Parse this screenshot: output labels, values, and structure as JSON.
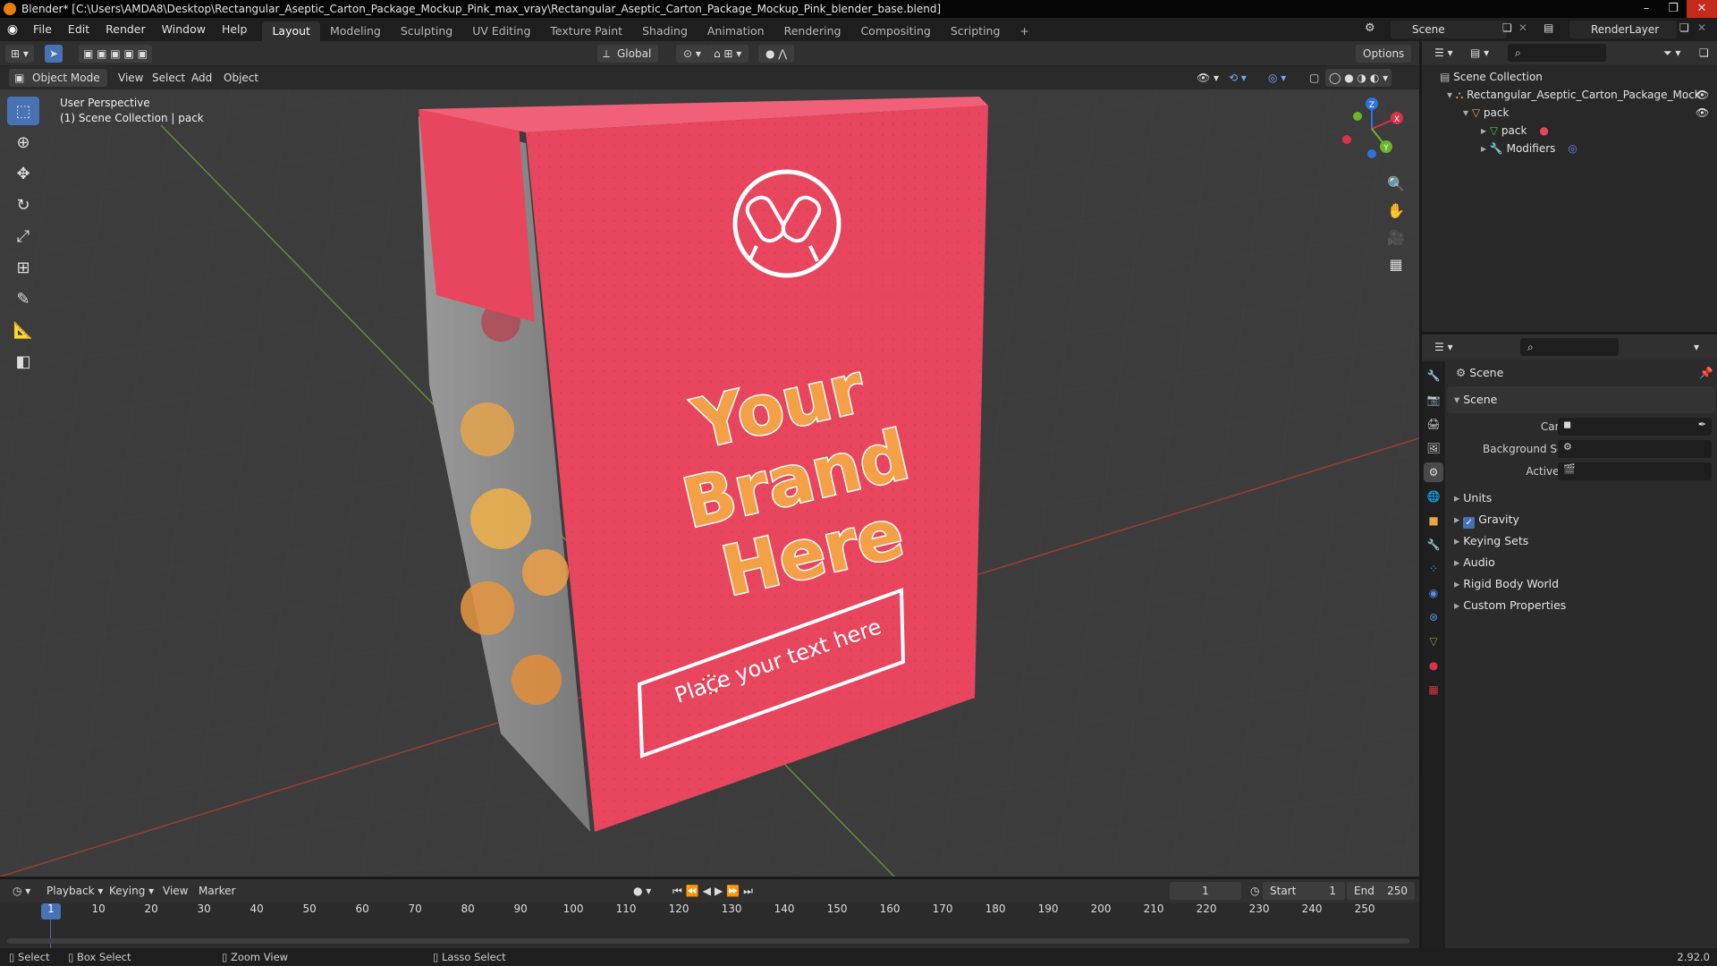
{
  "window": {
    "title": "Blender* [C:\\Users\\AMDA8\\Desktop\\Rectangular_Aseptic_Carton_Package_Mockup_Pink_max_vray\\Rectangular_Aseptic_Carton_Package_Mockup_Pink_blender_base.blend]"
  },
  "menu": {
    "items": [
      "File",
      "Edit",
      "Render",
      "Window",
      "Help"
    ]
  },
  "workspaces": [
    "Layout",
    "Modeling",
    "Sculpting",
    "UV Editing",
    "Texture Paint",
    "Shading",
    "Animation",
    "Rendering",
    "Compositing",
    "Scripting"
  ],
  "workspace_add": "+",
  "scene_field": "Scene",
  "renderlayer_field": "RenderLayer",
  "viewport_header": {
    "transform": "Global",
    "options": "Options"
  },
  "viewport_menu": {
    "mode": "Object Mode",
    "items": [
      "View",
      "Select",
      "Add",
      "Object"
    ]
  },
  "viewport": {
    "perspective": "User Perspective",
    "collection": "(1) Scene Collection | pack"
  },
  "gizmo": {
    "x": "X",
    "y": "Y",
    "z": "Z"
  },
  "carton": {
    "brand_line1": "Your",
    "brand_line2": "Brand",
    "brand_line3": "Here",
    "tagline": "Place your text here",
    "color": "#e8465e"
  },
  "outliner": {
    "root": "Scene Collection",
    "collection": "Rectangular_Aseptic_Carton_Package_Mock",
    "object": "pack",
    "mesh": "pack",
    "modifiers": "Modifiers"
  },
  "properties": {
    "context": "Scene",
    "panel": "Scene",
    "fields": [
      {
        "label": "Camera",
        "value": ""
      },
      {
        "label": "Background Scene",
        "value": ""
      },
      {
        "label": "Active Clip",
        "value": ""
      }
    ],
    "sections": [
      {
        "name": "Units",
        "checkbox": false
      },
      {
        "name": "Gravity",
        "checkbox": true
      },
      {
        "name": "Keying Sets",
        "checkbox": false
      },
      {
        "name": "Audio",
        "checkbox": false
      },
      {
        "name": "Rigid Body World",
        "checkbox": false
      },
      {
        "name": "Custom Properties",
        "checkbox": false
      }
    ]
  },
  "timeline": {
    "menus": [
      "Playback",
      "Keying",
      "View",
      "Marker"
    ],
    "current_frame": "1",
    "start_label": "Start",
    "start": "1",
    "end_label": "End",
    "end": "250",
    "ruler": [
      "1",
      "10",
      "20",
      "30",
      "40",
      "50",
      "60",
      "70",
      "80",
      "90",
      "100",
      "110",
      "120",
      "130",
      "140",
      "150",
      "160",
      "170",
      "180",
      "190",
      "200",
      "210",
      "220",
      "230",
      "240",
      "250"
    ]
  },
  "status": {
    "select": "Select",
    "box_select": "Box Select",
    "zoom_view": "Zoom View",
    "lasso_select": "Lasso Select",
    "version": "2.92.0"
  },
  "colors": {
    "accent": "#4772b3",
    "brand_orange": "#e87d0d",
    "carton_pink": "#e8465e",
    "text_orange": "#f3a046"
  }
}
